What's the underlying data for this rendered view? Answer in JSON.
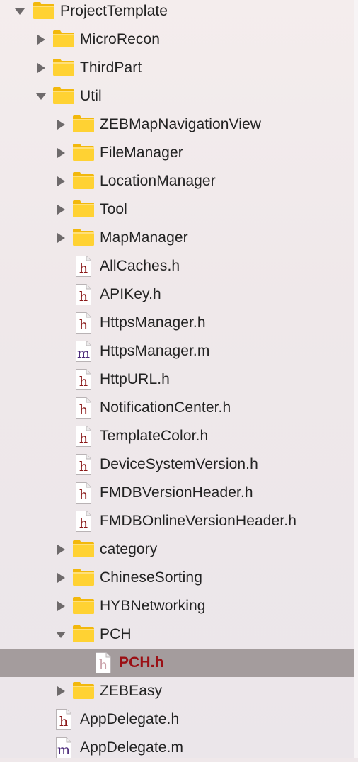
{
  "navigator": {
    "rows": [
      {
        "label": "ProjectTemplate",
        "kind": "folder",
        "expanded": true
      },
      {
        "label": "MicroRecon",
        "kind": "folder",
        "expanded": false
      },
      {
        "label": "ThirdPart",
        "kind": "folder",
        "expanded": false
      },
      {
        "label": "Util",
        "kind": "folder",
        "expanded": true
      },
      {
        "label": "ZEBMapNavigationView",
        "kind": "folder",
        "expanded": false
      },
      {
        "label": "FileManager",
        "kind": "folder",
        "expanded": false
      },
      {
        "label": "LocationManager",
        "kind": "folder",
        "expanded": false
      },
      {
        "label": "Tool",
        "kind": "folder",
        "expanded": false
      },
      {
        "label": "MapManager",
        "kind": "folder",
        "expanded": false
      },
      {
        "label": "AllCaches.h",
        "kind": "header-file",
        "glyph": "h"
      },
      {
        "label": "APIKey.h",
        "kind": "header-file",
        "glyph": "h"
      },
      {
        "label": "HttpsManager.h",
        "kind": "header-file",
        "glyph": "h"
      },
      {
        "label": "HttpsManager.m",
        "kind": "implementation-file",
        "glyph": "m"
      },
      {
        "label": "HttpURL.h",
        "kind": "header-file",
        "glyph": "h"
      },
      {
        "label": "NotificationCenter.h",
        "kind": "header-file",
        "glyph": "h"
      },
      {
        "label": "TemplateColor.h",
        "kind": "header-file",
        "glyph": "h"
      },
      {
        "label": "DeviceSystemVersion.h",
        "kind": "header-file",
        "glyph": "h"
      },
      {
        "label": "FMDBVersionHeader.h",
        "kind": "header-file",
        "glyph": "h"
      },
      {
        "label": "FMDBOnlineVersionHeader.h",
        "kind": "header-file",
        "glyph": "h"
      },
      {
        "label": "category",
        "kind": "folder",
        "expanded": false
      },
      {
        "label": "ChineseSorting",
        "kind": "folder",
        "expanded": false
      },
      {
        "label": "HYBNetworking",
        "kind": "folder",
        "expanded": false
      },
      {
        "label": "PCH",
        "kind": "folder",
        "expanded": true
      },
      {
        "label": "PCH.h",
        "kind": "header-file",
        "glyph": "h",
        "selected": true
      },
      {
        "label": "ZEBEasy",
        "kind": "folder",
        "expanded": false
      },
      {
        "label": "AppDelegate.h",
        "kind": "header-file",
        "glyph": "h"
      },
      {
        "label": "AppDelegate.m",
        "kind": "implementation-file",
        "glyph": "m"
      }
    ]
  },
  "colors": {
    "selection_background": "#a49c9d",
    "selected_text": "#9b0f14",
    "header_glyph": "#8b1a1a",
    "implementation_glyph": "#4b2a7a",
    "folder_body": "#ffd233",
    "folder_tab": "#f2b80c"
  },
  "icons": {
    "folder": "folder-icon",
    "header_file": "header-file-icon",
    "implementation_file": "implementation-file-icon",
    "expanded": "disclosure-triangle-down-icon",
    "collapsed": "disclosure-triangle-right-icon"
  }
}
